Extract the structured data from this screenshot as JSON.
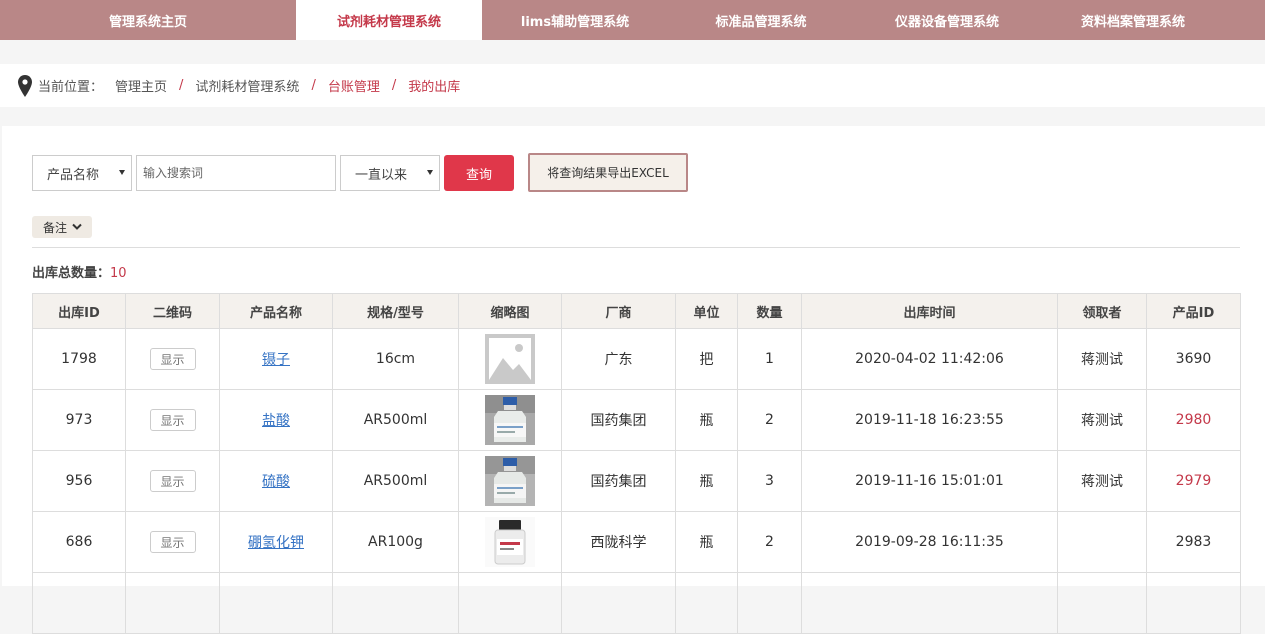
{
  "nav": {
    "tabs": [
      {
        "label": "管理系统主页",
        "active": false
      },
      {
        "label": "试剂耗材管理系统",
        "active": true
      },
      {
        "label": "lims辅助管理系统",
        "active": false
      },
      {
        "label": "标准品管理系统",
        "active": false
      },
      {
        "label": "仪器设备管理系统",
        "active": false
      },
      {
        "label": "资料档案管理系统",
        "active": false
      }
    ]
  },
  "breadcrumb": {
    "label": "当前位置：",
    "items": [
      "管理主页",
      "试剂耗材管理系统",
      "台账管理",
      "我的出库"
    ],
    "separator": "/"
  },
  "filters": {
    "field_select": "产品名称",
    "search_placeholder": "输入搜索词",
    "time_select": "一直以来",
    "query_label": "查询",
    "export_label": "将查询结果导出EXCEL"
  },
  "note_toggle": "备注",
  "total": {
    "label": "出库总数量：",
    "value": "10"
  },
  "table": {
    "headers": [
      "出库ID",
      "二维码",
      "产品名称",
      "规格/型号",
      "缩略图",
      "厂商",
      "单位",
      "数量",
      "出库时间",
      "领取者",
      "产品ID"
    ],
    "show_label": "显示",
    "rows": [
      {
        "id": "1798",
        "name": "镊子",
        "spec": "16cm",
        "thumb": "placeholder",
        "vendor": "广东",
        "unit": "把",
        "qty": "1",
        "time": "2020-04-02 11:42:06",
        "receiver": "蒋测试",
        "pid": "3690",
        "pid_red": false
      },
      {
        "id": "973",
        "name": "盐酸",
        "spec": "AR500ml",
        "thumb": "bottle-clear",
        "vendor": "国药集团",
        "unit": "瓶",
        "qty": "2",
        "time": "2019-11-18 16:23:55",
        "receiver": "蒋测试",
        "pid": "2980",
        "pid_red": true
      },
      {
        "id": "956",
        "name": "硫酸",
        "spec": "AR500ml",
        "thumb": "bottle-clear",
        "vendor": "国药集团",
        "unit": "瓶",
        "qty": "3",
        "time": "2019-11-16 15:01:01",
        "receiver": "蒋测试",
        "pid": "2979",
        "pid_red": true
      },
      {
        "id": "686",
        "name": "硼氢化钾",
        "spec": "AR100g",
        "thumb": "jar-white",
        "vendor": "西陇科学",
        "unit": "瓶",
        "qty": "2",
        "time": "2019-09-28 16:11:35",
        "receiver": "",
        "pid": "2983",
        "pid_red": false
      }
    ]
  },
  "colors": {
    "nav_bg": "#b98787",
    "accent_red": "#e0374a",
    "link_blue": "#3573c4"
  }
}
